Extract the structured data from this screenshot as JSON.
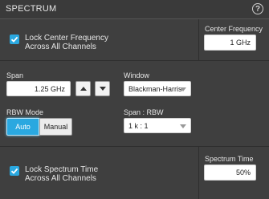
{
  "header": {
    "title": "SPECTRUM",
    "help_icon": "?"
  },
  "center_frequency": {
    "lock_label_line1": "Lock Center Frequency",
    "lock_label_line2": "Across All Channels",
    "lock_checked": true,
    "label": "Center Frequency",
    "value": "1 GHz"
  },
  "span": {
    "label": "Span",
    "value": "1.25 GHz"
  },
  "window": {
    "label": "Window",
    "selected": "Blackman-Harris"
  },
  "rbw_mode": {
    "label": "RBW Mode",
    "auto_label": "Auto",
    "manual_label": "Manual",
    "selected": "Auto"
  },
  "span_rbw": {
    "label": "Span : RBW",
    "selected": "1 k : 1"
  },
  "spectrum_time": {
    "lock_label_line1": "Lock Spectrum Time",
    "lock_label_line2": "Across All Channels",
    "lock_checked": true,
    "label": "Spectrum Time",
    "value": "50%"
  },
  "colors": {
    "accent": "#2aa8e0",
    "panel": "#3f3f3f"
  }
}
